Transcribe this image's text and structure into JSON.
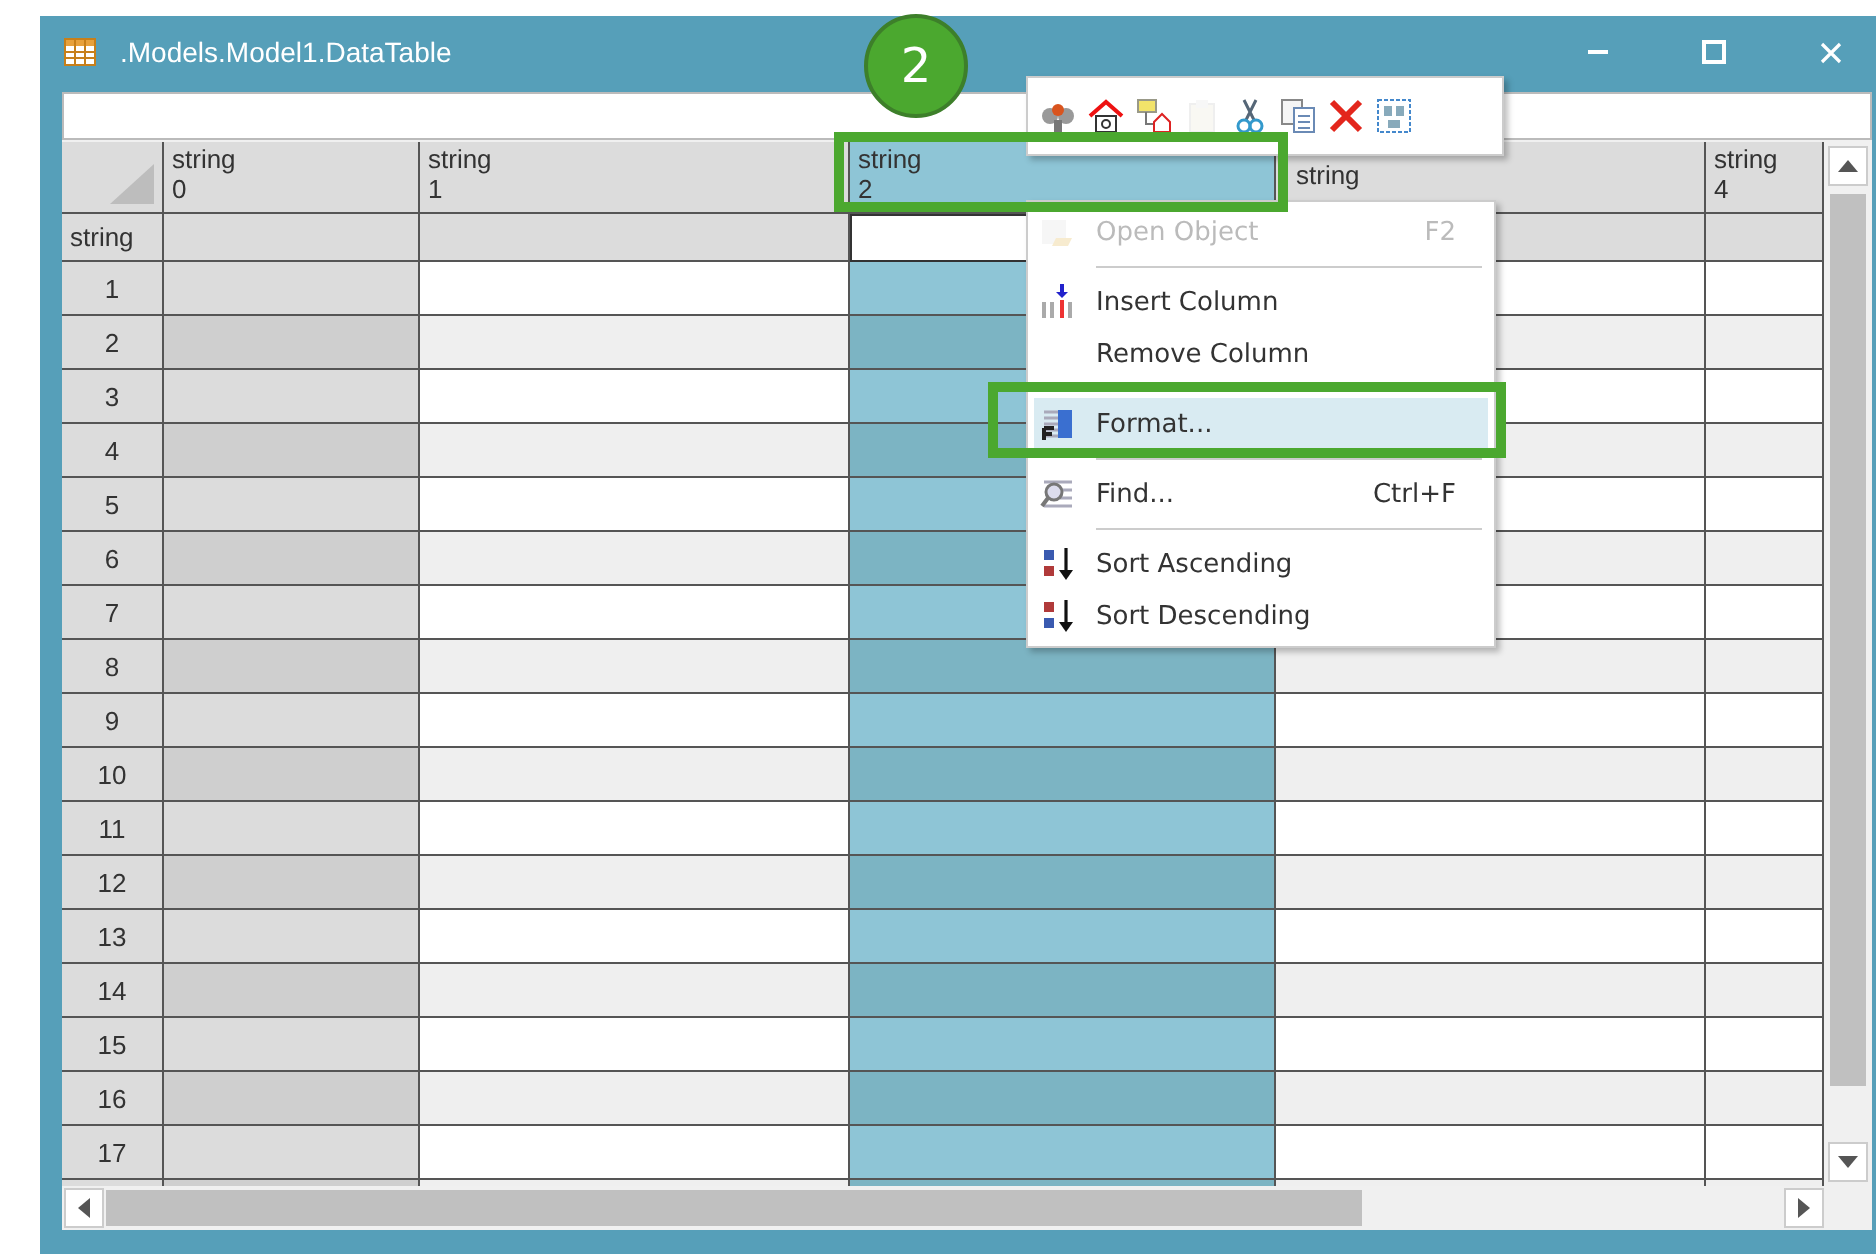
{
  "window": {
    "title": ".Models.Model1.DataTable"
  },
  "grid": {
    "columns": [
      {
        "label": "string",
        "number": "0",
        "selected": false
      },
      {
        "label": "string",
        "number": "1",
        "selected": false
      },
      {
        "label": "string",
        "number": "2",
        "selected": true
      },
      {
        "label": "string",
        "selected": false
      },
      {
        "label": "string",
        "number": "4",
        "selected": false
      }
    ],
    "type_row_label": "string",
    "rows": [
      "1",
      "2",
      "3",
      "4",
      "5",
      "6",
      "7",
      "8",
      "9",
      "10",
      "11",
      "12",
      "13",
      "14",
      "15",
      "16",
      "17"
    ]
  },
  "toolbar_buttons": [
    {
      "kind": "pin",
      "disabled": false
    },
    {
      "kind": "home",
      "disabled": false
    },
    {
      "kind": "shapes",
      "disabled": false
    },
    {
      "kind": "paste",
      "disabled": true
    },
    {
      "kind": "cut",
      "disabled": false
    },
    {
      "kind": "copy",
      "disabled": false
    },
    {
      "kind": "delete",
      "disabled": false
    },
    {
      "kind": "text",
      "disabled": false
    }
  ],
  "context_menu": [
    {
      "kind": "item",
      "label": "Open Object",
      "shortcut": "F2",
      "disabled": true,
      "selected": false
    },
    {
      "kind": "separator"
    },
    {
      "kind": "item",
      "label": "Insert Column",
      "disabled": false,
      "selected": false
    },
    {
      "kind": "item",
      "label": "Remove Column",
      "disabled": false,
      "selected": false
    },
    {
      "kind": "separator"
    },
    {
      "kind": "item",
      "label": "Format...",
      "disabled": false,
      "selected": true
    },
    {
      "kind": "separator"
    },
    {
      "kind": "item",
      "label": "Find...",
      "shortcut": "Ctrl+F",
      "disabled": false,
      "selected": false
    },
    {
      "kind": "separator"
    },
    {
      "kind": "item",
      "label": "Sort Ascending",
      "disabled": false,
      "selected": false
    },
    {
      "kind": "item",
      "label": "Sort Descending",
      "disabled": false,
      "selected": false
    }
  ],
  "callout": {
    "label": "2"
  }
}
